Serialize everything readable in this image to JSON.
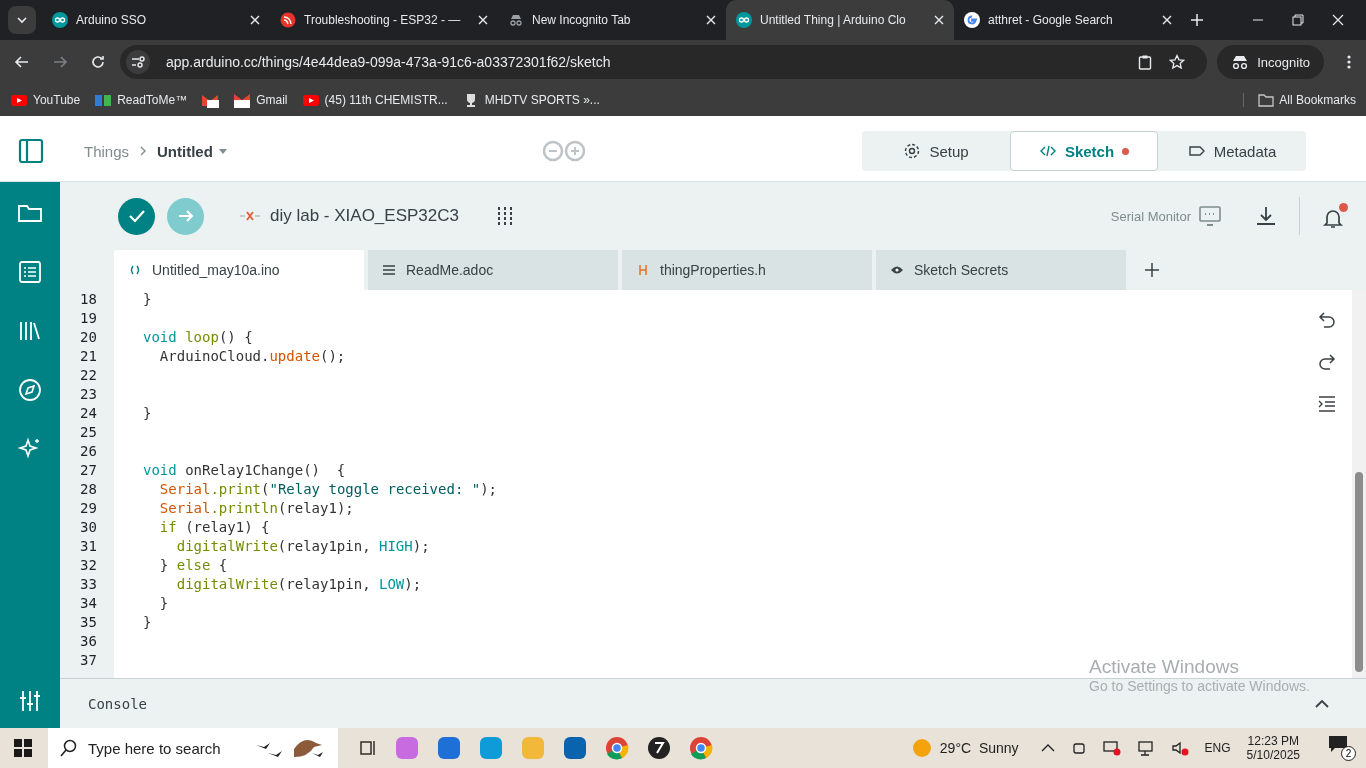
{
  "browser": {
    "tabs": [
      {
        "title": "Arduino SSO",
        "selected": false
      },
      {
        "title": "Troubleshooting - ESP32 - —",
        "selected": false
      },
      {
        "title": "New Incognito Tab",
        "selected": false
      },
      {
        "title": "Untitled Thing | Arduino Clo",
        "selected": true
      },
      {
        "title": "atthret - Google Search",
        "selected": false
      }
    ],
    "url": "app.arduino.cc/things/4e44dea9-099a-473a-91c6-a03372301f62/sketch",
    "profile": "Incognito",
    "bookmarks": [
      "YouTube",
      "ReadToMe™",
      "Gmail",
      "(45) 11th CHEMISTR...",
      "MHDTV SPORTS »..."
    ],
    "all_bookmarks": "All Bookmarks"
  },
  "header": {
    "breadcrumb": [
      "Things",
      "Untitled"
    ],
    "modes": [
      {
        "label": "Setup",
        "selected": false,
        "unsaved": false
      },
      {
        "label": "Sketch",
        "selected": true,
        "unsaved": true
      },
      {
        "label": "Metadata",
        "selected": false,
        "unsaved": false
      }
    ]
  },
  "toolbar": {
    "device": "diy lab - XIAO_ESP32C3",
    "connected": false,
    "serial_monitor": "Serial Monitor",
    "notification": true
  },
  "file_tabs": [
    {
      "label": "Untitled_may10a.ino",
      "selected": true
    },
    {
      "label": "ReadMe.adoc",
      "selected": false
    },
    {
      "label": "thingProperties.h",
      "selected": false
    },
    {
      "label": "Sketch Secrets",
      "selected": false
    }
  ],
  "code": [
    {
      "number": "18",
      "tokens": [
        {
          "kind": "plain",
          "text": "}"
        }
      ]
    },
    {
      "number": "19"
    },
    {
      "number": "20",
      "tokens": [
        {
          "kind": "keyword",
          "text": "void"
        },
        {
          "kind": "function",
          "text": " loop"
        },
        {
          "kind": "plain",
          "text": "() {"
        }
      ]
    },
    {
      "number": "21",
      "tokens": [
        {
          "kind": "plain",
          "text": "  ArduinoCloud."
        },
        {
          "kind": "method",
          "text": "update"
        },
        {
          "kind": "plain",
          "text": "();"
        }
      ]
    },
    {
      "number": "22"
    },
    {
      "number": "23"
    },
    {
      "number": "24",
      "tokens": [
        {
          "kind": "plain",
          "text": "}"
        }
      ]
    },
    {
      "number": "25"
    },
    {
      "number": "26"
    },
    {
      "number": "27",
      "tokens": [
        {
          "kind": "keyword",
          "text": "void"
        },
        {
          "kind": "plain",
          "text": " onRelay1Change()  {"
        }
      ]
    },
    {
      "number": "28",
      "tokens": [
        {
          "kind": "method",
          "text": "  Serial"
        },
        {
          "kind": "function",
          "text": ".print"
        },
        {
          "kind": "plain",
          "text": "("
        },
        {
          "kind": "string",
          "text": "\"Relay toggle received: \""
        },
        {
          "kind": "plain",
          "text": ");"
        }
      ]
    },
    {
      "number": "29",
      "tokens": [
        {
          "kind": "method",
          "text": "  Serial"
        },
        {
          "kind": "function",
          "text": ".println"
        },
        {
          "kind": "plain",
          "text": "(relay1);"
        }
      ]
    },
    {
      "number": "30",
      "tokens": [
        {
          "kind": "function",
          "text": "  if"
        },
        {
          "kind": "plain",
          "text": " (relay1) {"
        }
      ]
    },
    {
      "number": "31",
      "tokens": [
        {
          "kind": "function",
          "text": "    digitalWrite"
        },
        {
          "kind": "plain",
          "text": "(relay1pin, "
        },
        {
          "kind": "constant",
          "text": "HIGH"
        },
        {
          "kind": "plain",
          "text": ");"
        }
      ]
    },
    {
      "number": "32",
      "tokens": [
        {
          "kind": "plain",
          "text": "  } "
        },
        {
          "kind": "function",
          "text": "else"
        },
        {
          "kind": "plain",
          "text": " {"
        }
      ]
    },
    {
      "number": "33",
      "tokens": [
        {
          "kind": "function",
          "text": "    digitalWrite"
        },
        {
          "kind": "plain",
          "text": "(relay1pin, "
        },
        {
          "kind": "constant",
          "text": "LOW"
        },
        {
          "kind": "plain",
          "text": ");"
        }
      ]
    },
    {
      "number": "34",
      "tokens": [
        {
          "kind": "plain",
          "text": "  }"
        }
      ]
    },
    {
      "number": "35",
      "tokens": [
        {
          "kind": "plain",
          "text": "}"
        }
      ]
    },
    {
      "number": "36"
    },
    {
      "number": "37"
    }
  ],
  "console": {
    "label": "Console",
    "expanded": false
  },
  "activation": {
    "title": "Activate Windows",
    "subtitle": "Go to Settings to activate Windows."
  },
  "taskbar": {
    "search_placeholder": "Type here to search",
    "weather": "29°C  Sunny",
    "language": "ENG",
    "time": "12:23 PM",
    "date": "5/10/2025",
    "notifications": "2"
  }
}
